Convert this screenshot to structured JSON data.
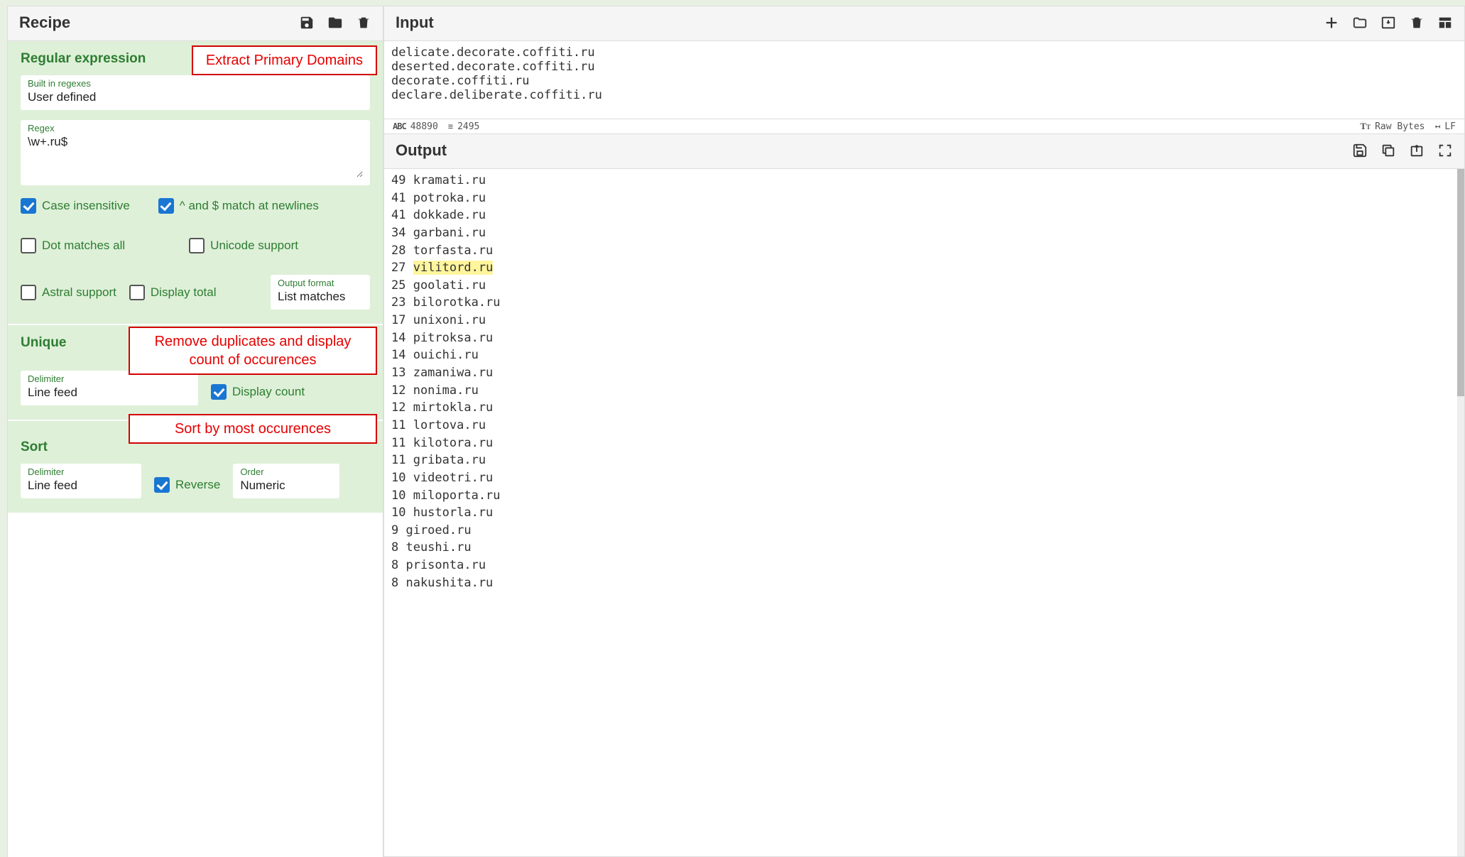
{
  "recipe": {
    "title": "Recipe",
    "ops": {
      "regex": {
        "title": "Regular expression",
        "annotation": "Extract Primary Domains",
        "builtin_label": "Built in regexes",
        "builtin_value": "User defined",
        "regex_label": "Regex",
        "regex_value": "\\w+.ru$",
        "chk_case": "Case insensitive",
        "chk_newlines": "^ and $ match at newlines",
        "chk_dot": "Dot matches all",
        "chk_unicode": "Unicode support",
        "chk_astral": "Astral support",
        "chk_total": "Display total",
        "outfmt_label": "Output format",
        "outfmt_value": "List matches"
      },
      "unique": {
        "title": "Unique",
        "annotation": "Remove duplicates and display count of occurences",
        "delim_label": "Delimiter",
        "delim_value": "Line feed",
        "chk_count": "Display count"
      },
      "sort": {
        "title": "Sort",
        "annotation": "Sort by most occurences",
        "delim_label": "Delimiter",
        "delim_value": "Line feed",
        "chk_reverse": "Reverse",
        "order_label": "Order",
        "order_value": "Numeric"
      }
    }
  },
  "input": {
    "title": "Input",
    "lines": [
      "delicate.decorate.coffiti.ru",
      "deserted.decorate.coffiti.ru",
      "decorate.coffiti.ru",
      "declare.deliberate.coffiti.ru"
    ],
    "status": {
      "chars": "48890",
      "lines": "2495",
      "encoding": "Raw Bytes",
      "eol": "LF"
    }
  },
  "output": {
    "title": "Output",
    "highlighted_domain": "vilitord.ru",
    "rows": [
      {
        "n": "49",
        "d": "kramati.ru"
      },
      {
        "n": "41",
        "d": "potroka.ru"
      },
      {
        "n": "41",
        "d": "dokkade.ru"
      },
      {
        "n": "34",
        "d": "garbani.ru"
      },
      {
        "n": "28",
        "d": "torfasta.ru"
      },
      {
        "n": "27",
        "d": "vilitord.ru"
      },
      {
        "n": "25",
        "d": "goolati.ru"
      },
      {
        "n": "23",
        "d": "bilorotka.ru"
      },
      {
        "n": "17",
        "d": "unixoni.ru"
      },
      {
        "n": "14",
        "d": "pitroksa.ru"
      },
      {
        "n": "14",
        "d": "ouichi.ru"
      },
      {
        "n": "13",
        "d": "zamaniwa.ru"
      },
      {
        "n": "12",
        "d": "nonima.ru"
      },
      {
        "n": "12",
        "d": "mirtokla.ru"
      },
      {
        "n": "11",
        "d": "lortova.ru"
      },
      {
        "n": "11",
        "d": "kilotora.ru"
      },
      {
        "n": "11",
        "d": "gribata.ru"
      },
      {
        "n": "10",
        "d": "videotri.ru"
      },
      {
        "n": "10",
        "d": "miloporta.ru"
      },
      {
        "n": "10",
        "d": "hustorla.ru"
      },
      {
        "n": "9",
        "d": "giroed.ru"
      },
      {
        "n": "8",
        "d": "teushi.ru"
      },
      {
        "n": "8",
        "d": "prisonta.ru"
      },
      {
        "n": "8",
        "d": "nakushita.ru"
      }
    ]
  }
}
